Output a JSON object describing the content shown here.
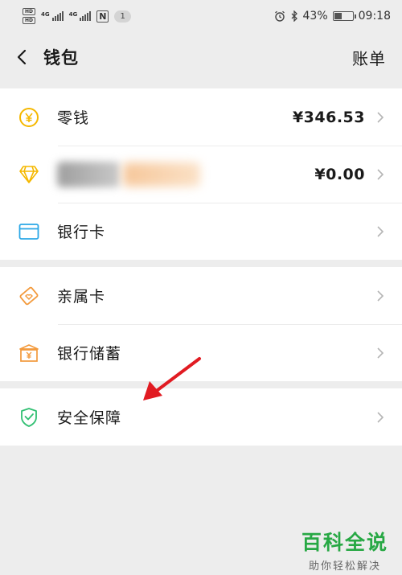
{
  "status_bar": {
    "network_left_1": "4G",
    "network_left_2": "4G",
    "nfc": "N",
    "notification_count": "1",
    "battery": "43%",
    "time": "09:18"
  },
  "nav": {
    "title": "钱包",
    "action": "账单"
  },
  "groups": [
    {
      "rows": [
        {
          "label": "零钱",
          "value": "¥346.53",
          "icon": "coin-icon"
        },
        {
          "label": "",
          "value": "¥0.00",
          "icon": "diamond-icon",
          "blurred": true
        },
        {
          "label": "银行卡",
          "value": "",
          "icon": "bank-card-icon"
        }
      ]
    },
    {
      "rows": [
        {
          "label": "亲属卡",
          "value": "",
          "icon": "family-card-icon"
        },
        {
          "label": "银行储蓄",
          "value": "",
          "icon": "bank-savings-icon"
        }
      ]
    },
    {
      "rows": [
        {
          "label": "安全保障",
          "value": "",
          "icon": "shield-icon"
        }
      ]
    }
  ],
  "watermark": {
    "title": "百科全说",
    "subtitle": "助你轻松解决"
  },
  "colors": {
    "accent_yellow": "#f5b800",
    "accent_blue": "#2aa7e6",
    "accent_orange": "#f39a3c",
    "accent_green": "#2fbf71",
    "arrow_red": "#e11b22"
  }
}
